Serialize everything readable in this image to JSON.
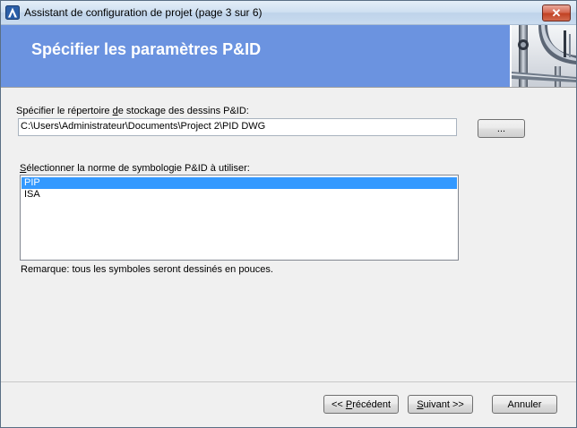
{
  "window": {
    "title": "Assistant de configuration de projet (page 3 sur 6)",
    "close_label": "✕"
  },
  "banner": {
    "title": "Spécifier les paramètres P&ID",
    "background": "#6b93e0"
  },
  "directory": {
    "label_before": "Spécifier le répertoire ",
    "label_accel": "d",
    "label_after": "e stockage des dessins P&ID:",
    "value": "C:\\Users\\Administrateur\\Documents\\Project 2\\PID DWG",
    "browse_label": "..."
  },
  "symbology": {
    "label_accel": "S",
    "label_after": "électionner la norme de symbologie P&ID à utiliser:",
    "items": [
      {
        "label": "PIP",
        "selected": true
      },
      {
        "label": "ISA",
        "selected": false
      }
    ],
    "selection_color": "#3399ff"
  },
  "note": "Remarque: tous les symboles seront dessinés en pouces.",
  "buttons": {
    "back_prefix": "<< ",
    "back_accel": "P",
    "back_rest": "récédent",
    "next_prefix": "",
    "next_accel": "S",
    "next_rest": "uivant >>",
    "cancel": "Annuler"
  }
}
